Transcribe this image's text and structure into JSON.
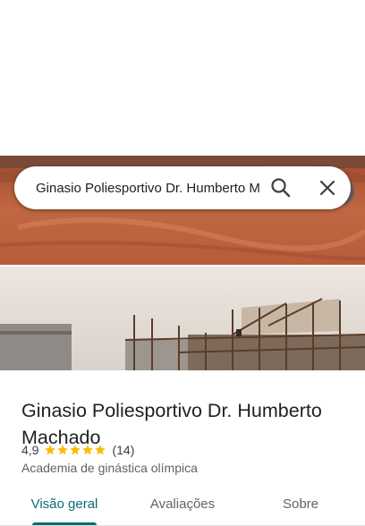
{
  "search": {
    "query": "Ginasio Poliesportivo Dr. Humberto Machado"
  },
  "place": {
    "name": "Ginasio Poliesportivo Dr. Humberto Machado",
    "rating": "4,9",
    "rating_fraction": 0.98,
    "review_count": "(14)",
    "category": "Academia de ginástica olímpica"
  },
  "tabs": [
    {
      "label": "Visão geral",
      "active": true
    },
    {
      "label": "Avaliações",
      "active": false
    },
    {
      "label": "Sobre",
      "active": false
    }
  ],
  "colors": {
    "accent": "#0b6b74",
    "star": "#fbbc04",
    "dirt": "#b8603c"
  },
  "icons": [
    "search-icon",
    "close-icon",
    "star-icon"
  ]
}
